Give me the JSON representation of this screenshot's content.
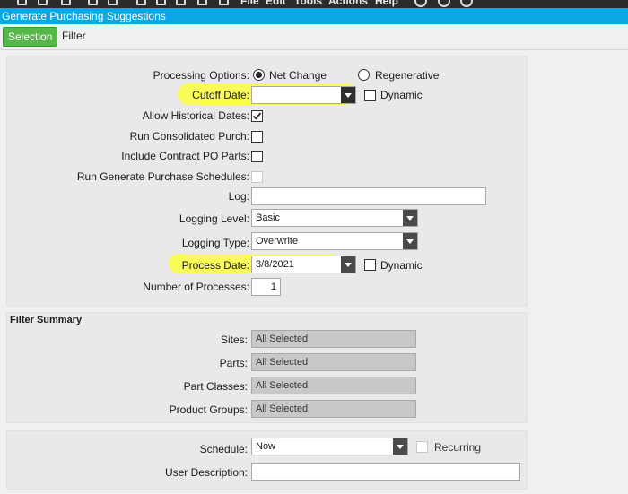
{
  "window": {
    "title": "Generate Purchasing Suggestions"
  },
  "menu": {
    "items": [
      "File",
      "Edit",
      "Tools",
      "Actions",
      "Help"
    ]
  },
  "tabs": {
    "selection": "Selection",
    "filter": "Filter"
  },
  "options": {
    "processing_options_label": "Processing Options:",
    "net_change_label": "Net Change",
    "regenerative_label": "Regenerative",
    "processing_option_selected": "Net Change",
    "cutoff_date_label": "Cutoff Date:",
    "cutoff_date_value": "",
    "cutoff_dynamic_label": "Dynamic",
    "cutoff_dynamic_checked": false,
    "allow_historical_label": "Allow Historical Dates:",
    "allow_historical_checked": true,
    "run_consolidated_label": "Run Consolidated Purch:",
    "run_consolidated_checked": false,
    "include_contract_label": "Include Contract PO Parts:",
    "include_contract_checked": false,
    "run_schedules_label": "Run Generate Purchase Schedules:",
    "run_schedules_checked": false,
    "log_label": "Log:",
    "log_value": "",
    "logging_level_label": "Logging Level:",
    "logging_level_value": "Basic",
    "logging_type_label": "Logging Type:",
    "logging_type_value": "Overwrite",
    "process_date_label": "Process Date:",
    "process_date_value": "3/8/2021",
    "process_dynamic_label": "Dynamic",
    "process_dynamic_checked": false,
    "num_processes_label": "Number of Processes:",
    "num_processes_value": "1"
  },
  "filter_summary": {
    "title": "Filter Summary",
    "sites_label": "Sites:",
    "sites_value": "All Selected",
    "parts_label": "Parts:",
    "parts_value": "All Selected",
    "part_classes_label": "Part Classes:",
    "part_classes_value": "All Selected",
    "product_groups_label": "Product Groups:",
    "product_groups_value": "All Selected"
  },
  "schedule": {
    "schedule_label": "Schedule:",
    "schedule_value": "Now",
    "recurring_label": "Recurring",
    "recurring_checked": false,
    "user_description_label": "User Description:",
    "user_description_value": ""
  },
  "colors": {
    "title_bar": "#0aa8e5",
    "active_tab": "#55b848",
    "highlight": "#ffff28",
    "panel_bg": "#e9e9e9",
    "readonly_bg": "#c8c8c8"
  }
}
